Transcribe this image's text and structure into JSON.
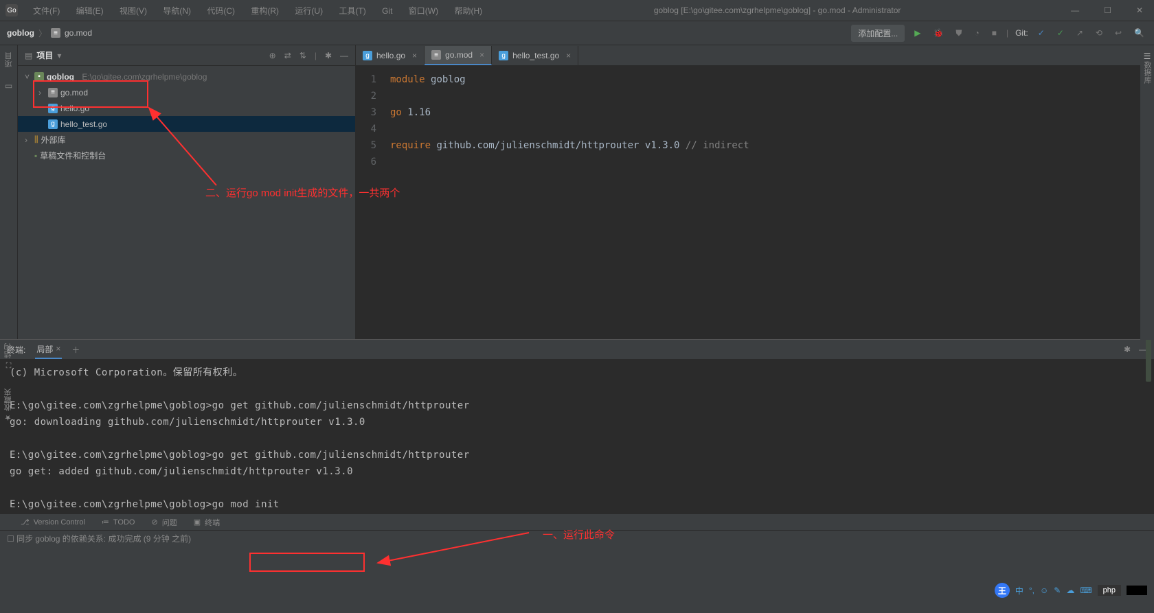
{
  "window": {
    "title": "goblog [E:\\go\\gitee.com\\zgrhelpme\\goblog] - go.mod - Administrator"
  },
  "menu": {
    "items": [
      "文件(F)",
      "编辑(E)",
      "视图(V)",
      "导航(N)",
      "代码(C)",
      "重构(R)",
      "运行(U)",
      "工具(T)",
      "Git",
      "窗口(W)",
      "帮助(H)"
    ]
  },
  "breadcrumb": {
    "root": "goblog",
    "file": "go.mod"
  },
  "toolbar": {
    "add_config": "添加配置...",
    "git_label": "Git:"
  },
  "project_pane": {
    "label": "项目",
    "left_tab": "项目",
    "root": {
      "name": "goblog",
      "path": "E:\\go\\gitee.com\\zgrhelpme\\goblog"
    },
    "files": [
      "go.mod",
      "hello.go",
      "hello_test.go"
    ],
    "external": "外部库",
    "scratches": "草稿文件和控制台"
  },
  "editor_tabs": [
    {
      "name": "hello.go",
      "active": false
    },
    {
      "name": "go.mod",
      "active": true
    },
    {
      "name": "hello_test.go",
      "active": false
    }
  ],
  "code": {
    "lines": [
      "1",
      "2",
      "3",
      "4",
      "5",
      "6"
    ],
    "l1_kw": "module",
    "l1_id": "goblog",
    "l3_kw": "go",
    "l3_v": "1.16",
    "l5_kw": "require",
    "l5_pkg": "github.com/julienschmidt/httprouter",
    "l5_ver": "v1.3.0",
    "l5_cm": "// indirect"
  },
  "right_tab": "数据库",
  "terminal": {
    "header_label": "终端:",
    "tab": "局部",
    "lines": [
      "(c) Microsoft Corporation。保留所有权利。",
      "",
      "E:\\go\\gitee.com\\zgrhelpme\\goblog>go get github.com/julienschmidt/httprouter",
      "go: downloading github.com/julienschmidt/httprouter v1.3.0",
      "",
      "E:\\go\\gitee.com\\zgrhelpme\\goblog>go get github.com/julienschmidt/httprouter",
      "go get: added github.com/julienschmidt/httprouter v1.3.0",
      "",
      "E:\\go\\gitee.com\\zgrhelpme\\goblog>go mod init"
    ]
  },
  "bottom_tabs": {
    "vc": "Version Control",
    "todo": "TODO",
    "issues": "问题",
    "terminal": "终端"
  },
  "status": {
    "text": "同步 goblog 的依赖关系: 成功完成 (9 分钟 之前)"
  },
  "annotations": {
    "a1": "一、运行此命令",
    "a2": "二、运行go mod init生成的文件，一共两个"
  },
  "left_vbar": {
    "fav": "收藏夹",
    "struct": "结构"
  },
  "ime": {
    "char": "中"
  },
  "badges": {
    "w": "王",
    "php": "php"
  }
}
